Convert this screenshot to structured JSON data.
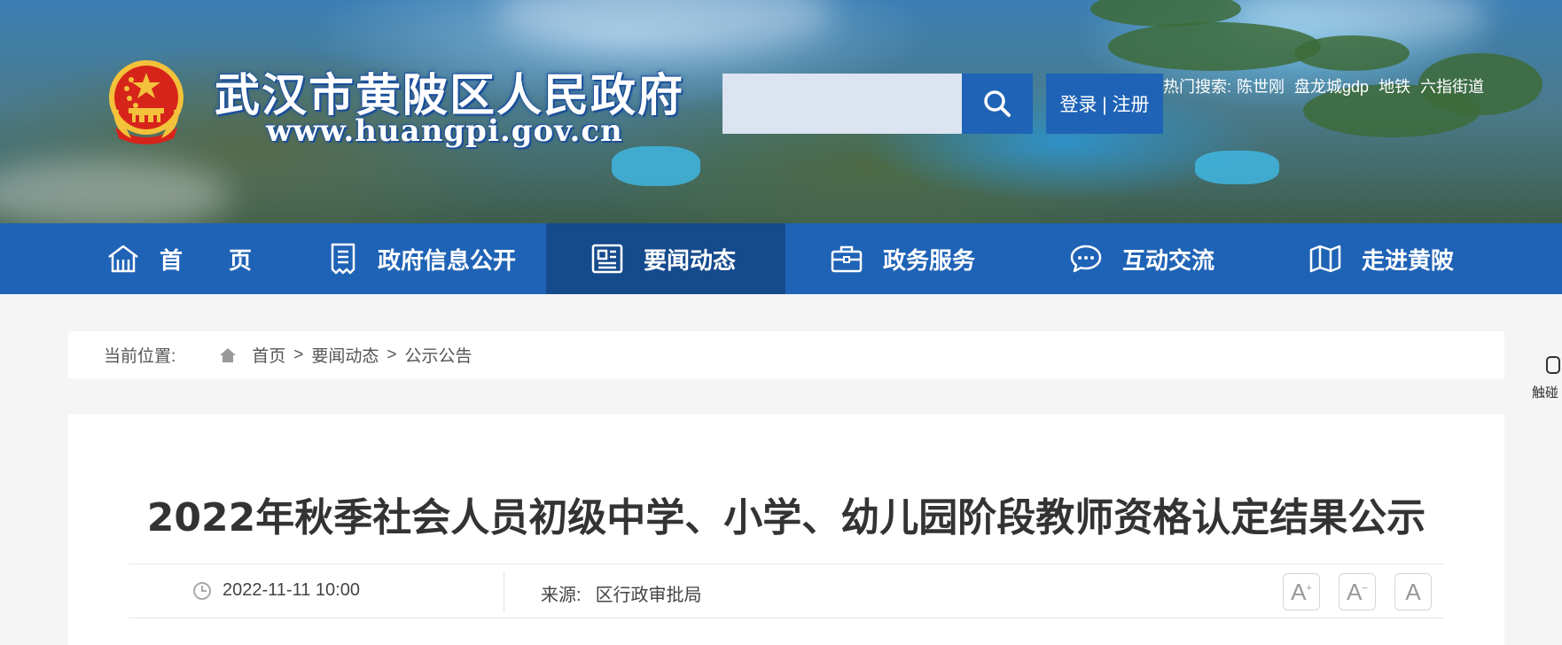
{
  "header": {
    "site_title": "武汉市黄陂区人民政府",
    "site_url": "www.huangpi.gov.cn",
    "search_placeholder": "",
    "login_label": "登录 | 注册",
    "hot_search_label": "热门搜索:",
    "hot_search_terms": [
      "陈世刚",
      "盘龙城gdp",
      "地铁",
      "六指街道"
    ]
  },
  "nav": {
    "items": [
      {
        "label": "首　　页",
        "icon": "home-icon"
      },
      {
        "label": "政府信息公开",
        "icon": "document-icon"
      },
      {
        "label": "要闻动态",
        "icon": "news-icon"
      },
      {
        "label": "政务服务",
        "icon": "briefcase-icon"
      },
      {
        "label": "互动交流",
        "icon": "chat-icon"
      },
      {
        "label": "走进黄陂",
        "icon": "map-icon"
      }
    ],
    "active_index": 2
  },
  "breadcrumb": {
    "label": "当前位置:",
    "items": [
      "首页",
      "要闻动态",
      "公示公告"
    ],
    "separator": ">"
  },
  "side_widget": {
    "label": "触碰"
  },
  "article": {
    "title": "2022年秋季社会人员初级中学、小学、幼儿园阶段教师资格认定结果公示",
    "date": "2022-11-11 10:00",
    "source_label": "来源:",
    "source_value": "区行政审批局",
    "font_buttons": [
      "A+",
      "A-",
      "A"
    ]
  },
  "colors": {
    "nav_bg": "#1f63b6",
    "nav_active": "#154a8c",
    "search_bg": "#dbe4f0",
    "title_text": "#333333"
  }
}
